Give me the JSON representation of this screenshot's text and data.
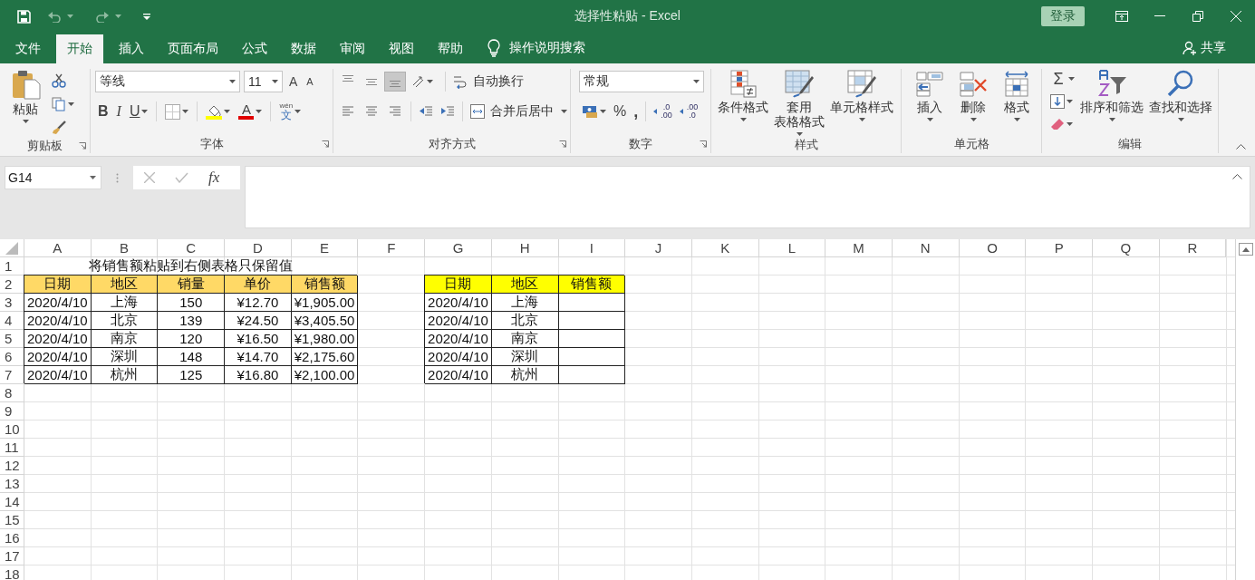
{
  "window": {
    "title": "选择性粘贴 - Excel",
    "sign_in": "登录"
  },
  "ribbon_tabs": [
    {
      "label": "文件",
      "selected": false
    },
    {
      "label": "开始",
      "selected": true
    },
    {
      "label": "插入",
      "selected": false
    },
    {
      "label": "页面布局",
      "selected": false
    },
    {
      "label": "公式",
      "selected": false
    },
    {
      "label": "数据",
      "selected": false
    },
    {
      "label": "审阅",
      "selected": false
    },
    {
      "label": "视图",
      "selected": false
    },
    {
      "label": "帮助",
      "selected": false
    }
  ],
  "tell_me": "操作说明搜索",
  "share": "共享",
  "ribbon": {
    "clipboard": {
      "paste": "粘贴",
      "label": "剪贴板"
    },
    "font": {
      "name": "等线",
      "size": "11",
      "grow": "A",
      "shrink": "A",
      "bold": "B",
      "italic": "I",
      "underline": "U",
      "font_color": "A",
      "phonetic_top": "wén",
      "phonetic": "文",
      "label": "字体"
    },
    "alignment": {
      "vertical_buttons": [
        {
          "selected": false
        },
        {
          "selected": false
        },
        {
          "selected": true
        }
      ],
      "wrap": "自动换行",
      "merge": "合并后居中",
      "label": "对齐方式"
    },
    "number": {
      "format": "常规",
      "percent": "%",
      "comma": ",",
      "decimal_buttons": [
        {
          "top": ".0",
          "bottom": ".00"
        },
        {
          "top": ".00",
          "bottom": ".0"
        }
      ],
      "label": "数字"
    },
    "styles": {
      "buttons": [
        [
          "条件格式"
        ],
        [
          "套用",
          "表格格式"
        ],
        [
          "单元格样式"
        ]
      ],
      "label": "样式"
    },
    "cells": {
      "buttons": [
        "插入",
        "删除",
        "格式"
      ],
      "label": "单元格"
    },
    "editing": {
      "autosum": "Σ",
      "buttons": [
        "排序和筛选",
        "查找和选择"
      ],
      "label": "编辑"
    }
  },
  "formula_bar": {
    "name_box": "G14",
    "function_label": "fx"
  },
  "sheet": {
    "columns": [
      "A",
      "B",
      "C",
      "D",
      "E",
      "F",
      "G",
      "H",
      "I",
      "J",
      "K",
      "L",
      "M",
      "N",
      "O",
      "P",
      "Q",
      "R"
    ],
    "rows": [
      {
        "label": "1",
        "cells": [
          {
            "text": "将销售额粘贴到右侧表格只保留值",
            "merged": true
          }
        ]
      },
      {
        "label": "2",
        "cells": [
          {
            "text": "日期",
            "bordered": true,
            "color": "#ffd966"
          },
          {
            "text": "地区",
            "bordered": true,
            "color": "#ffd966"
          },
          {
            "text": "销量",
            "bordered": true,
            "color": "#ffd966"
          },
          {
            "text": "单价",
            "bordered": true,
            "color": "#ffd966"
          },
          {
            "text": "销售额",
            "bordered": true,
            "color": "#ffd966"
          },
          null,
          {
            "text": "日期",
            "bordered": true,
            "color": "#ffff00"
          },
          {
            "text": "地区",
            "bordered": true,
            "color": "#ffff00"
          },
          {
            "text": "销售额",
            "bordered": true,
            "color": "#ffff00"
          }
        ]
      },
      {
        "label": "3",
        "cells": [
          {
            "text": "2020/4/10",
            "bordered": true
          },
          {
            "text": "上海",
            "bordered": true
          },
          {
            "text": "150",
            "bordered": true
          },
          {
            "text": "¥12.70",
            "bordered": true
          },
          {
            "text": "¥1,905.00",
            "bordered": true
          },
          null,
          {
            "text": "2020/4/10",
            "bordered": true
          },
          {
            "text": "上海",
            "bordered": true
          },
          {
            "bordered": true
          }
        ]
      },
      {
        "label": "4",
        "cells": [
          {
            "text": "2020/4/10",
            "bordered": true
          },
          {
            "text": "北京",
            "bordered": true
          },
          {
            "text": "139",
            "bordered": true
          },
          {
            "text": "¥24.50",
            "bordered": true
          },
          {
            "text": "¥3,405.50",
            "bordered": true
          },
          null,
          {
            "text": "2020/4/10",
            "bordered": true
          },
          {
            "text": "北京",
            "bordered": true
          },
          {
            "bordered": true
          }
        ]
      },
      {
        "label": "5",
        "cells": [
          {
            "text": "2020/4/10",
            "bordered": true
          },
          {
            "text": "南京",
            "bordered": true
          },
          {
            "text": "120",
            "bordered": true
          },
          {
            "text": "¥16.50",
            "bordered": true
          },
          {
            "text": "¥1,980.00",
            "bordered": true
          },
          null,
          {
            "text": "2020/4/10",
            "bordered": true
          },
          {
            "text": "南京",
            "bordered": true
          },
          {
            "bordered": true
          }
        ]
      },
      {
        "label": "6",
        "cells": [
          {
            "text": "2020/4/10",
            "bordered": true
          },
          {
            "text": "深圳",
            "bordered": true
          },
          {
            "text": "148",
            "bordered": true
          },
          {
            "text": "¥14.70",
            "bordered": true
          },
          {
            "text": "¥2,175.60",
            "bordered": true
          },
          null,
          {
            "text": "2020/4/10",
            "bordered": true
          },
          {
            "text": "深圳",
            "bordered": true
          },
          {
            "bordered": true
          }
        ]
      },
      {
        "label": "7",
        "cells": [
          {
            "text": "2020/4/10",
            "bordered": true
          },
          {
            "text": "杭州",
            "bordered": true
          },
          {
            "text": "125",
            "bordered": true
          },
          {
            "text": "¥16.80",
            "bordered": true
          },
          {
            "text": "¥2,100.00",
            "bordered": true
          },
          null,
          {
            "text": "2020/4/10",
            "bordered": true
          },
          {
            "text": "杭州",
            "bordered": true
          },
          {
            "bordered": true
          }
        ]
      },
      {
        "label": "8"
      },
      {
        "label": "9"
      },
      {
        "label": "10"
      },
      {
        "label": "11"
      },
      {
        "label": "12"
      },
      {
        "label": "13"
      },
      {
        "label": "14"
      },
      {
        "label": "15"
      },
      {
        "label": "16"
      },
      {
        "label": "17"
      },
      {
        "label": "18"
      }
    ]
  }
}
